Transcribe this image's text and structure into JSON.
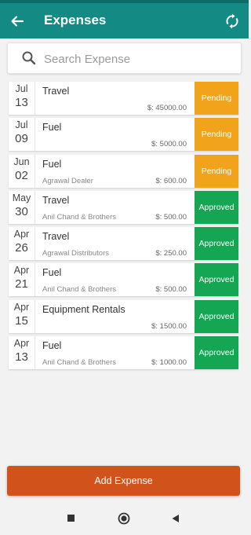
{
  "header": {
    "title": "Expenses"
  },
  "search": {
    "placeholder": "Search Expense",
    "value": ""
  },
  "expenses": [
    {
      "month": "Jul",
      "day": "13",
      "category": "Travel",
      "vendor": "",
      "amount": "$: 45000.00",
      "status": "Pending"
    },
    {
      "month": "Jul",
      "day": "09",
      "category": "Fuel",
      "vendor": "",
      "amount": "$: 5000.00",
      "status": "Pending"
    },
    {
      "month": "Jun",
      "day": "02",
      "category": "Fuel",
      "vendor": "Agrawal Dealer",
      "amount": "$: 600.00",
      "status": "Pending"
    },
    {
      "month": "May",
      "day": "30",
      "category": "Travel",
      "vendor": "Anil Chand & Brothers",
      "amount": "$: 500.00",
      "status": "Approved"
    },
    {
      "month": "Apr",
      "day": "26",
      "category": "Travel",
      "vendor": "Agrawal Distributors",
      "amount": "$: 250.00",
      "status": "Approved"
    },
    {
      "month": "Apr",
      "day": "21",
      "category": "Fuel",
      "vendor": "Anil Chand & Brothers",
      "amount": "$: 500.00",
      "status": "Approved"
    },
    {
      "month": "Apr",
      "day": "15",
      "category": "Equipment Rentals",
      "vendor": "",
      "amount": "$: 1500.00",
      "status": "Approved"
    },
    {
      "month": "Apr",
      "day": "13",
      "category": "Fuel",
      "vendor": "Anil Chand & Brothers",
      "amount": "$: 1000.00",
      "status": "Approved"
    }
  ],
  "footer": {
    "add_label": "Add Expense"
  },
  "colors": {
    "appbar": "#138a84",
    "pending": "#f2a31c",
    "approved": "#14a653",
    "add_button": "#d2521c"
  },
  "icons": {
    "back": "arrow-left-icon",
    "sync": "sync-icon",
    "search": "search-icon",
    "nav_recent": "square-icon",
    "nav_home": "circle-icon",
    "nav_back": "triangle-left-icon"
  }
}
